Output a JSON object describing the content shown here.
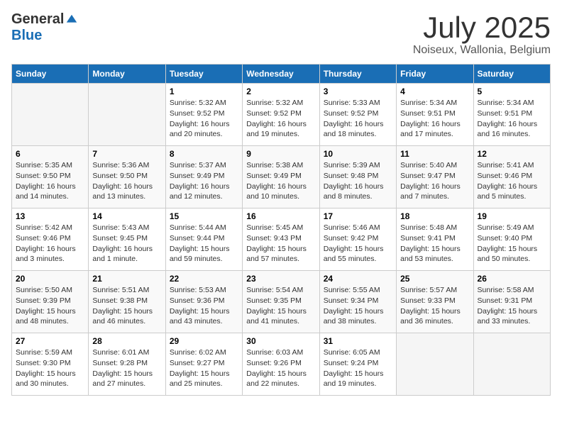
{
  "header": {
    "logo_general": "General",
    "logo_blue": "Blue",
    "month": "July 2025",
    "location": "Noiseux, Wallonia, Belgium"
  },
  "weekdays": [
    "Sunday",
    "Monday",
    "Tuesday",
    "Wednesday",
    "Thursday",
    "Friday",
    "Saturday"
  ],
  "weeks": [
    [
      {
        "day": "",
        "info": ""
      },
      {
        "day": "",
        "info": ""
      },
      {
        "day": "1",
        "info": "Sunrise: 5:32 AM\nSunset: 9:52 PM\nDaylight: 16 hours and 20 minutes."
      },
      {
        "day": "2",
        "info": "Sunrise: 5:32 AM\nSunset: 9:52 PM\nDaylight: 16 hours and 19 minutes."
      },
      {
        "day": "3",
        "info": "Sunrise: 5:33 AM\nSunset: 9:52 PM\nDaylight: 16 hours and 18 minutes."
      },
      {
        "day": "4",
        "info": "Sunrise: 5:34 AM\nSunset: 9:51 PM\nDaylight: 16 hours and 17 minutes."
      },
      {
        "day": "5",
        "info": "Sunrise: 5:34 AM\nSunset: 9:51 PM\nDaylight: 16 hours and 16 minutes."
      }
    ],
    [
      {
        "day": "6",
        "info": "Sunrise: 5:35 AM\nSunset: 9:50 PM\nDaylight: 16 hours and 14 minutes."
      },
      {
        "day": "7",
        "info": "Sunrise: 5:36 AM\nSunset: 9:50 PM\nDaylight: 16 hours and 13 minutes."
      },
      {
        "day": "8",
        "info": "Sunrise: 5:37 AM\nSunset: 9:49 PM\nDaylight: 16 hours and 12 minutes."
      },
      {
        "day": "9",
        "info": "Sunrise: 5:38 AM\nSunset: 9:49 PM\nDaylight: 16 hours and 10 minutes."
      },
      {
        "day": "10",
        "info": "Sunrise: 5:39 AM\nSunset: 9:48 PM\nDaylight: 16 hours and 8 minutes."
      },
      {
        "day": "11",
        "info": "Sunrise: 5:40 AM\nSunset: 9:47 PM\nDaylight: 16 hours and 7 minutes."
      },
      {
        "day": "12",
        "info": "Sunrise: 5:41 AM\nSunset: 9:46 PM\nDaylight: 16 hours and 5 minutes."
      }
    ],
    [
      {
        "day": "13",
        "info": "Sunrise: 5:42 AM\nSunset: 9:46 PM\nDaylight: 16 hours and 3 minutes."
      },
      {
        "day": "14",
        "info": "Sunrise: 5:43 AM\nSunset: 9:45 PM\nDaylight: 16 hours and 1 minute."
      },
      {
        "day": "15",
        "info": "Sunrise: 5:44 AM\nSunset: 9:44 PM\nDaylight: 15 hours and 59 minutes."
      },
      {
        "day": "16",
        "info": "Sunrise: 5:45 AM\nSunset: 9:43 PM\nDaylight: 15 hours and 57 minutes."
      },
      {
        "day": "17",
        "info": "Sunrise: 5:46 AM\nSunset: 9:42 PM\nDaylight: 15 hours and 55 minutes."
      },
      {
        "day": "18",
        "info": "Sunrise: 5:48 AM\nSunset: 9:41 PM\nDaylight: 15 hours and 53 minutes."
      },
      {
        "day": "19",
        "info": "Sunrise: 5:49 AM\nSunset: 9:40 PM\nDaylight: 15 hours and 50 minutes."
      }
    ],
    [
      {
        "day": "20",
        "info": "Sunrise: 5:50 AM\nSunset: 9:39 PM\nDaylight: 15 hours and 48 minutes."
      },
      {
        "day": "21",
        "info": "Sunrise: 5:51 AM\nSunset: 9:38 PM\nDaylight: 15 hours and 46 minutes."
      },
      {
        "day": "22",
        "info": "Sunrise: 5:53 AM\nSunset: 9:36 PM\nDaylight: 15 hours and 43 minutes."
      },
      {
        "day": "23",
        "info": "Sunrise: 5:54 AM\nSunset: 9:35 PM\nDaylight: 15 hours and 41 minutes."
      },
      {
        "day": "24",
        "info": "Sunrise: 5:55 AM\nSunset: 9:34 PM\nDaylight: 15 hours and 38 minutes."
      },
      {
        "day": "25",
        "info": "Sunrise: 5:57 AM\nSunset: 9:33 PM\nDaylight: 15 hours and 36 minutes."
      },
      {
        "day": "26",
        "info": "Sunrise: 5:58 AM\nSunset: 9:31 PM\nDaylight: 15 hours and 33 minutes."
      }
    ],
    [
      {
        "day": "27",
        "info": "Sunrise: 5:59 AM\nSunset: 9:30 PM\nDaylight: 15 hours and 30 minutes."
      },
      {
        "day": "28",
        "info": "Sunrise: 6:01 AM\nSunset: 9:28 PM\nDaylight: 15 hours and 27 minutes."
      },
      {
        "day": "29",
        "info": "Sunrise: 6:02 AM\nSunset: 9:27 PM\nDaylight: 15 hours and 25 minutes."
      },
      {
        "day": "30",
        "info": "Sunrise: 6:03 AM\nSunset: 9:26 PM\nDaylight: 15 hours and 22 minutes."
      },
      {
        "day": "31",
        "info": "Sunrise: 6:05 AM\nSunset: 9:24 PM\nDaylight: 15 hours and 19 minutes."
      },
      {
        "day": "",
        "info": ""
      },
      {
        "day": "",
        "info": ""
      }
    ]
  ]
}
